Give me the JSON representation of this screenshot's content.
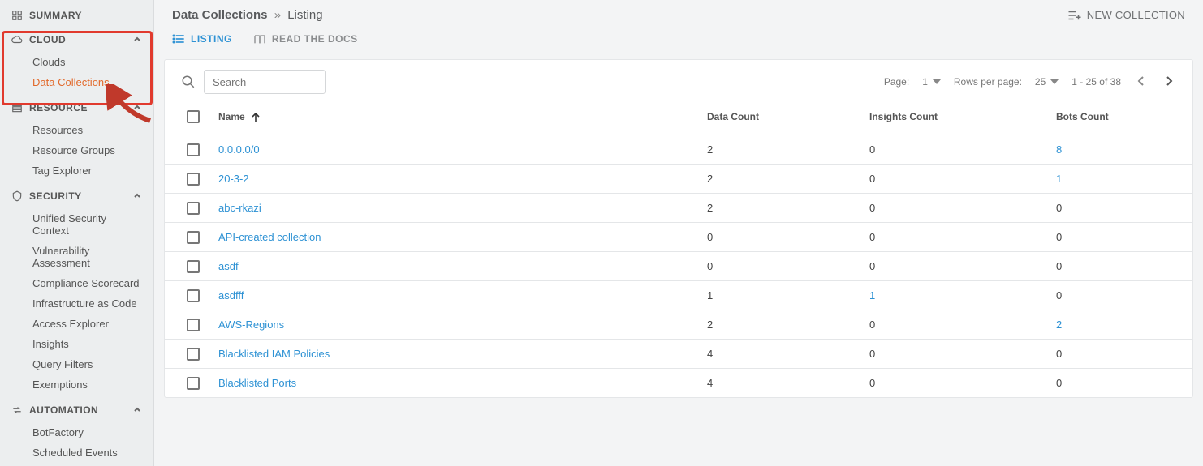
{
  "sidebar": {
    "summary": "SUMMARY",
    "groups": [
      {
        "label": "CLOUD",
        "items": [
          {
            "label": "Clouds"
          },
          {
            "label": "Data Collections",
            "active": true
          }
        ]
      },
      {
        "label": "RESOURCE",
        "items": [
          {
            "label": "Resources"
          },
          {
            "label": "Resource Groups"
          },
          {
            "label": "Tag Explorer"
          }
        ]
      },
      {
        "label": "SECURITY",
        "items": [
          {
            "label": "Unified Security Context"
          },
          {
            "label": "Vulnerability Assessment"
          },
          {
            "label": "Compliance Scorecard"
          },
          {
            "label": "Infrastructure as Code"
          },
          {
            "label": "Access Explorer"
          },
          {
            "label": "Insights"
          },
          {
            "label": "Query Filters"
          },
          {
            "label": "Exemptions"
          }
        ]
      },
      {
        "label": "AUTOMATION",
        "items": [
          {
            "label": "BotFactory"
          },
          {
            "label": "Scheduled Events"
          }
        ]
      }
    ]
  },
  "header": {
    "breadcrumb_root": "Data Collections",
    "breadcrumb_sep": "»",
    "breadcrumb_leaf": "Listing",
    "new_collection": "NEW COLLECTION"
  },
  "tabs": {
    "listing": "LISTING",
    "docs": "READ THE DOCS"
  },
  "search": {
    "placeholder": "Search"
  },
  "pager": {
    "page_label": "Page:",
    "page_value": "1",
    "rows_label": "Rows per page:",
    "rows_value": "25",
    "range": "1 - 25 of 38"
  },
  "table": {
    "headers": {
      "name": "Name",
      "data_count": "Data Count",
      "insights_count": "Insights Count",
      "bots_count": "Bots Count"
    },
    "rows": [
      {
        "name": "0.0.0.0/0",
        "data": "2",
        "insights": "0",
        "bots": "8",
        "bots_link": true
      },
      {
        "name": "20-3-2",
        "data": "2",
        "insights": "0",
        "bots": "1",
        "bots_link": true
      },
      {
        "name": "abc-rkazi",
        "data": "2",
        "insights": "0",
        "bots": "0"
      },
      {
        "name": "API-created collection",
        "data": "0",
        "insights": "0",
        "bots": "0"
      },
      {
        "name": "asdf",
        "data": "0",
        "insights": "0",
        "bots": "0"
      },
      {
        "name": "asdfff",
        "data": "1",
        "insights": "1",
        "insights_link": true,
        "bots": "0"
      },
      {
        "name": "AWS-Regions",
        "data": "2",
        "insights": "0",
        "bots": "2",
        "bots_link": true
      },
      {
        "name": "Blacklisted IAM Policies",
        "data": "4",
        "insights": "0",
        "bots": "0"
      },
      {
        "name": "Blacklisted Ports",
        "data": "4",
        "insights": "0",
        "bots": "0"
      }
    ]
  }
}
